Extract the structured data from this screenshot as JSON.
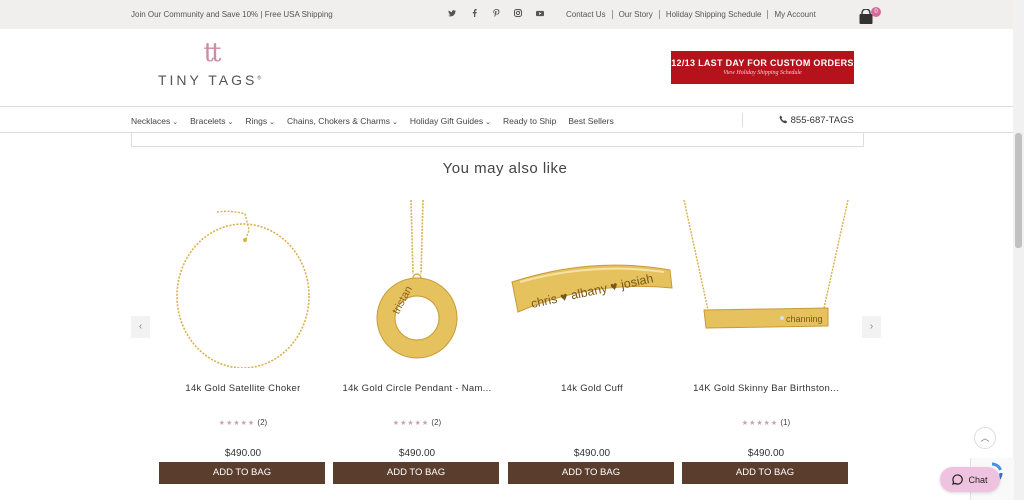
{
  "topbar": {
    "promo": "Join Our Community and Save 10% |   Free USA Shipping",
    "social_icons": [
      "twitter-icon",
      "facebook-icon",
      "pinterest-icon",
      "instagram-icon",
      "youtube-icon"
    ],
    "links": [
      "Contact Us",
      "Our Story",
      "Holiday Shipping Schedule",
      "My Account"
    ],
    "cart_count": "0"
  },
  "logo": {
    "mark": "tt",
    "name": "TINY TAGS",
    "trademark": "®"
  },
  "banner": {
    "line1": "12/13 LAST DAY FOR CUSTOM ORDERS",
    "line2": "View Holiday Shipping Schedule"
  },
  "nav": {
    "items": [
      "Necklaces",
      "Bracelets",
      "Rings",
      "Chains, Chokers & Charms",
      "Holiday Gift Guides",
      "Ready to Ship",
      "Best Sellers"
    ],
    "has_dropdown": [
      true,
      true,
      true,
      true,
      true,
      false,
      false
    ],
    "phone": "855-687-TAGS"
  },
  "section": {
    "title": "You may also like"
  },
  "products": [
    {
      "name": "14k Gold Satellite Choker",
      "stars": "★★★★★",
      "reviews": "(2)",
      "price": "$490.00",
      "button": "ADD TO BAG",
      "engraving": ""
    },
    {
      "name": "14k Gold Circle Pendant - Nam...",
      "stars": "★★★★★",
      "reviews": "(2)",
      "price": "$490.00",
      "button": "ADD TO BAG",
      "engraving": "tristan"
    },
    {
      "name": "14k Gold Cuff",
      "stars": "",
      "reviews": "",
      "price": "$490.00",
      "button": "ADD TO BAG",
      "engraving": "chris ♥ albany ♥ josiah"
    },
    {
      "name": "14K Gold Skinny Bar Birthston...",
      "stars": "★★★★★",
      "reviews": "(1)",
      "price": "$490.00",
      "button": "ADD TO BAG",
      "engraving": "channing"
    }
  ],
  "widgets": {
    "chat_label": "Chat"
  },
  "colors": {
    "brand_pink": "#d08aa8",
    "button_brown": "#5b3d2e",
    "banner_red": "#b5121b",
    "gold": "#d9b04c"
  }
}
